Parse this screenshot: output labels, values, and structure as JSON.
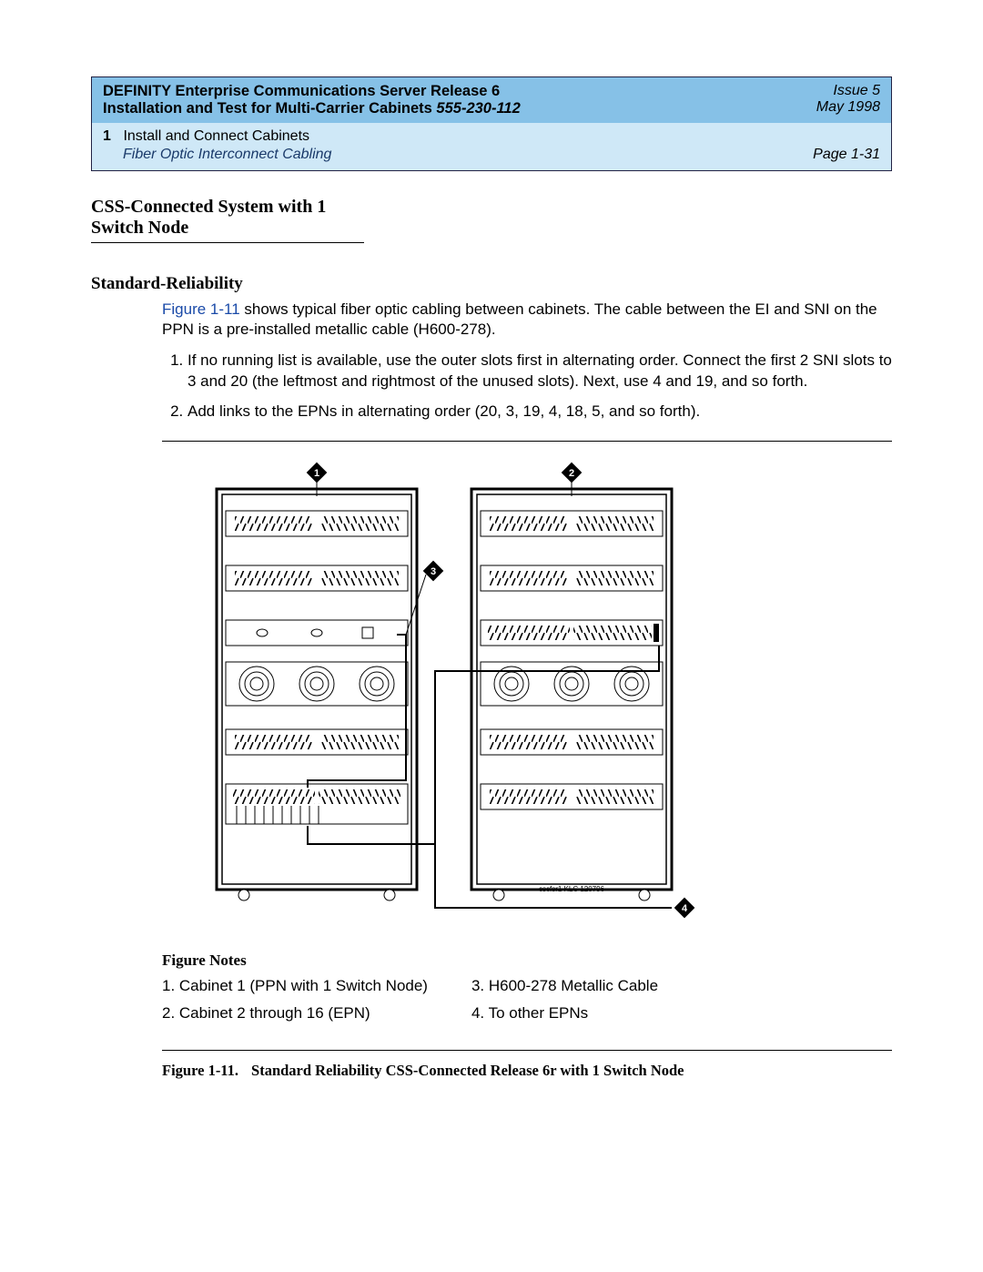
{
  "header": {
    "product_line1": "DEFINITY Enterprise Communications Server Release 6",
    "product_line2_a": "Installation and Test for Multi-Carrier Cabinets  ",
    "product_line2_b": "555-230-112",
    "issue": "Issue 5",
    "date": "May 1998",
    "chapter_num": "1",
    "chapter_title": "Install and Connect Cabinets",
    "section_title": "Fiber Optic Interconnect Cabling",
    "page_label": "Page 1-31"
  },
  "headings": {
    "h2": "CSS-Connected System with 1 Switch Node",
    "h3": "Standard-Reliability"
  },
  "intro": {
    "link_text": "Figure 1-11",
    "rest": " shows typical fiber optic cabling between cabinets. The cable between the EI and SNI on the PPN is a pre-installed metallic cable (H600-278)."
  },
  "steps": {
    "s1": "If no running list is available, use the outer slots first in alternating order. Connect the first 2 SNI slots to 3 and 20 (the leftmost and rightmost of the unused slots). Next, use 4 and 19, and so forth.",
    "s2": "Add links to the EPNs in alternating order (20, 3, 19, 4, 18, 5, and so forth)."
  },
  "callouts": {
    "c1": "1",
    "c2": "2",
    "c3": "3",
    "c4": "4"
  },
  "figure_ref": "cscfsr1 KLC 120796",
  "figure_notes_title": "Figure Notes",
  "figure_notes": {
    "n1": "1. Cabinet 1 (PPN with 1 Switch Node)",
    "n2": "2. Cabinet 2 through 16 (EPN)",
    "n3": "3. H600-278 Metallic Cable",
    "n4": "4. To other EPNs"
  },
  "caption": {
    "label": "Figure 1-11.",
    "text": "Standard Reliability CSS-Connected Release 6r with 1 Switch Node"
  }
}
